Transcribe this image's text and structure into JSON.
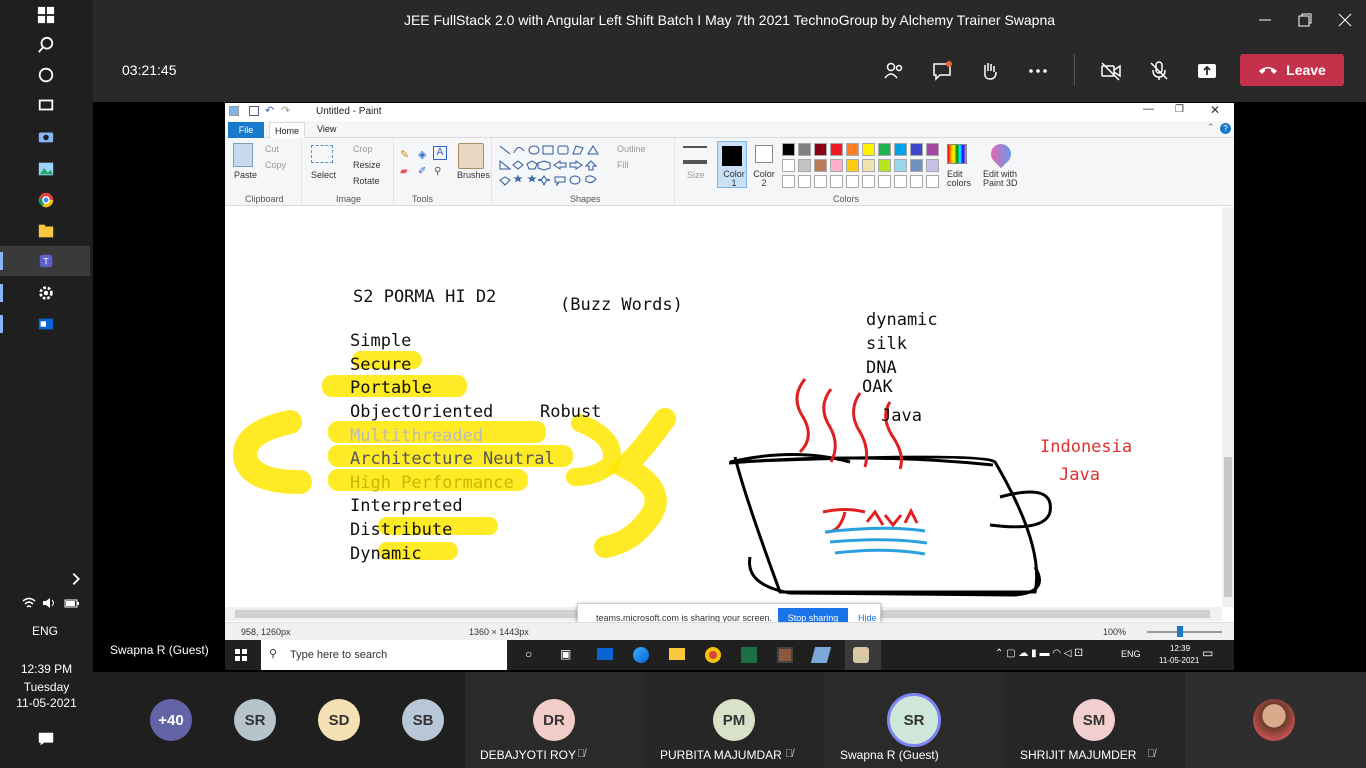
{
  "window": {
    "title": "JEE FullStack 2.0 with Angular Left Shift Batch I May 7th 2021 TechnoGroup by Alchemy Trainer Swapna"
  },
  "meeting": {
    "timer": "03:21:45",
    "leave_label": "Leave",
    "presenter_name": "Swapna R (Guest)"
  },
  "left_taskbar": {
    "lang": "ENG",
    "time": "12:39 PM",
    "day": "Tuesday",
    "date": "11-05-2021"
  },
  "paint": {
    "title": "Untitled - Paint",
    "tabs": [
      "File",
      "Home",
      "View"
    ],
    "clipboard": {
      "paste": "Paste",
      "cut": "Cut",
      "copy": "Copy",
      "group": "Clipboard"
    },
    "image": {
      "select": "Select",
      "crop": "Crop",
      "resize": "Resize",
      "rotate": "Rotate",
      "group": "Image"
    },
    "tools": {
      "group": "Tools",
      "brushes": "Brushes"
    },
    "shapes": {
      "group": "Shapes",
      "outline": "Outline",
      "fill": "Fill"
    },
    "size_label": "Size",
    "color1": "Color 1",
    "color2": "Color 2",
    "colors_group": "Colors",
    "edit_colors": "Edit colors",
    "edit_paint3d": "Edit with Paint 3D",
    "palette": [
      "#000000",
      "#7f7f7f",
      "#880015",
      "#ed1c24",
      "#ff7f27",
      "#fff200",
      "#22b14c",
      "#00a2e8",
      "#3f48cc",
      "#a349a4",
      "#ffffff",
      "#c3c3c3",
      "#b97a57",
      "#ffaec9",
      "#ffc90e",
      "#efe4b0",
      "#b5e61d",
      "#99d9ea",
      "#7092be",
      "#c8bfe7"
    ],
    "status": {
      "pos": "958, 1260px",
      "dims": "1360 × 1443px",
      "zoom": "100%"
    },
    "share_bar": {
      "text": "teams.microsoft.com is sharing your screen.",
      "stop": "Stop sharing",
      "hide": "Hide"
    }
  },
  "canvas": {
    "heading": "S2  PORMA HI D2",
    "buzz": "(Buzz Words)",
    "oak": "OAK",
    "list": [
      "Simple",
      "Secure",
      "Portable",
      "ObjectOriented",
      "Multithreaded",
      "Architecture Neutral",
      "High Performance",
      "Interpreted",
      "Distribute",
      "Dynamic"
    ],
    "robust": "Robust",
    "right_list": [
      "dynamic",
      "silk",
      "DNA"
    ],
    "java_word": "Java",
    "indonesia": "Indonesia",
    "java_red": "Java",
    "cup_label": "Java"
  },
  "inner_taskbar": {
    "search_placeholder": "Type here to search",
    "lang": "ENG",
    "time": "12:39",
    "date": "11-05-2021"
  },
  "roster": {
    "more_count": "+40",
    "small": [
      "SR",
      "SD",
      "SB"
    ],
    "tiles": [
      {
        "initials": "DR",
        "name": "DEBAJYOTI ROY"
      },
      {
        "initials": "PM",
        "name": "PURBITA MAJUMDAR"
      },
      {
        "initials": "SR",
        "name": "Swapna R (Guest)"
      },
      {
        "initials": "SM",
        "name": "SHRIJIT MAJUMDER"
      }
    ]
  },
  "colors": {
    "leave": "#c4314b",
    "accent": "#6264a7",
    "highlight": "#ffe600"
  }
}
